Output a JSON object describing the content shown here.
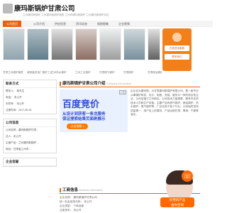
{
  "header": {
    "title": "康玛斯锅炉甘肃公司",
    "subtitle": "兰州康玛斯锅炉 兰州康玛斯锅炉销售 兰州市康玛斯锅炉 兰州康玛斯锅炉供应"
  },
  "nav": {
    "items": [
      "公司首页",
      "公司介绍",
      "供应信息",
      "资讯动态",
      "相册图集",
      "企业视频"
    ],
    "active_index": 0
  },
  "gallery": {
    "captions": [
      "甘肃兰州锅炉销售",
      "城阳鑫发电厂锅炉工业...",
      "兰州热水锅炉",
      "兰州工业锅炉",
      "甘肃燃气锅炉",
      "甘肃锅炉",
      "甘肃燃油锅炉",
      "蒸汽锅炉"
    ]
  },
  "side_panel": {
    "btn1": "在线咨询客服",
    "btn2": "联系我们"
  },
  "left": {
    "contact_header": "联系方式",
    "contact_lines": [
      "联系人：  某先生",
      "电话：  未公开",
      "手机号：  未公开",
      "注册时间：2017-05-26"
    ],
    "company_header": "公司信息",
    "company_lines": [
      "公司名称：康玛斯锅炉甘肃...",
      "法人：未公开",
      "主营产品：兰州康玛斯锅炉...",
      "地址：甘肃省兰州市..."
    ],
    "cert_header": "企业信誉"
  },
  "main": {
    "section1": "康玛斯锅炉甘肃公司介绍",
    "section1_tag": "Company Introduction",
    "ad_big": "百度竞价",
    "ad_l1": "从设计到获客一条龙服务",
    "ad_l2": "保证搜索结果页面刷展示",
    "ad_btn": "点击查看 >",
    "ad_label": "广告",
    "intro_text": "企业名为康玛斯，为甘肃康玛斯锅炉有限公司，是一家专业从事锅炉研发、设计、制造、安装、服务为一体的综合性企业，公司坐落于兰州新区。公司技术力量雄厚，拥有专业的技术人员和生产设备。主要产品有燃气锅炉、燃油锅炉、热水锅炉、蒸汽锅炉等，广泛应用于各个行业。公司始终坚持质量第一、用户至上的原则，产品远销甘肃、青海、宁夏等省区。",
    "section2": "工商信息",
    "section2_tag": "Business information",
    "biz_lines": [
      "企业名称：  康玛斯锅炉甘肃公司",
      "统一社会信用代码：  未公开",
      "企业类型：  个体经营",
      "注册资本：  未公开"
    ]
  },
  "chat": {
    "line1": "好用的产品",
    "line2": "由你咨询"
  },
  "colors": {
    "accent": "#e8620b",
    "ad_blue": "#2e4bd7"
  }
}
